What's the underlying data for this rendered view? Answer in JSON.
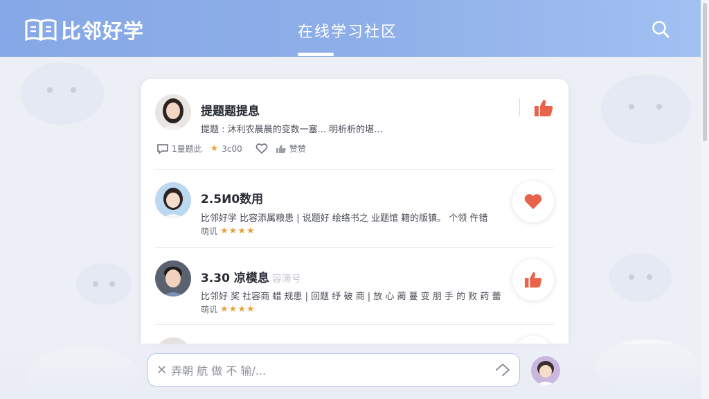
{
  "header": {
    "logo_text": "比邻好学",
    "title": "在线学习社区"
  },
  "posts": [
    {
      "title": "提题题提息",
      "text": "提题 : 沐利农晨晨的变数一塞... 明析析的堪...",
      "comments": "1量题此",
      "rating": "3с00",
      "like_label": "赞赞",
      "action": "thumbs-up"
    },
    {
      "title": "2.5И0数用",
      "text": "比邻好学 比容添属粮患 | 说题好 绘络书之 业题馆 籍的版镇。 个领 仵错",
      "rater": "萌讥",
      "stars": "★★★★",
      "action": "heart"
    },
    {
      "title": "3.30 凉模息",
      "title_faded": "容簿号",
      "text": "比邻好 奖 社容商 蜡 规患 | 回题 纾 破 商 | 放 心 蔺 蔓 变 朋 手 的 败 药 蕾",
      "rater": "萌讥",
      "stars": "★★★★",
      "action": "thumbs-up"
    }
  ],
  "composer": {
    "clear_glyph": "✕",
    "placeholder": "弄朝 航 做 不 输/..."
  },
  "colors": {
    "accent": "#e8634a",
    "header_start": "#86a8e6",
    "header_end": "#a1c0f2",
    "star": "#e8a23c"
  }
}
